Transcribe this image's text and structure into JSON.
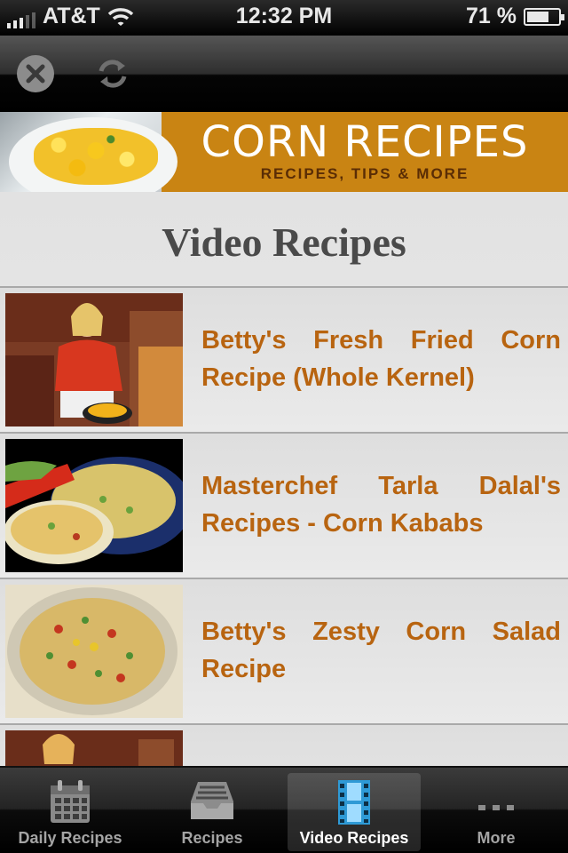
{
  "status_bar": {
    "carrier": "AT&T",
    "time": "12:32 PM",
    "battery": "71 %",
    "battery_level": 0.71
  },
  "toolbar": {
    "close_icon": "close-icon",
    "refresh_icon": "refresh-icon"
  },
  "banner": {
    "title": "CORN RECIPES",
    "subtitle": "RECIPES, TIPS & MORE"
  },
  "page": {
    "title": "Video Recipes"
  },
  "videos": [
    {
      "title": "Betty's Fresh Fried Corn Recipe (Whole Kernel)"
    },
    {
      "title": "Masterchef Tarla Dalal's Recipes - Corn Kababs"
    },
    {
      "title": "Betty's Zesty Corn Salad Recipe"
    },
    {
      "title": ""
    }
  ],
  "tabs": [
    {
      "label": "Daily Recipes",
      "icon": "calendar-icon",
      "active": false
    },
    {
      "label": "Recipes",
      "icon": "inbox-tray-icon",
      "active": false
    },
    {
      "label": "Video Recipes",
      "icon": "film-strip-icon",
      "active": true
    },
    {
      "label": "More",
      "icon": "more-dots-icon",
      "active": false
    }
  ],
  "colors": {
    "accent_text": "#b86410",
    "banner_bg": "#c98413"
  }
}
